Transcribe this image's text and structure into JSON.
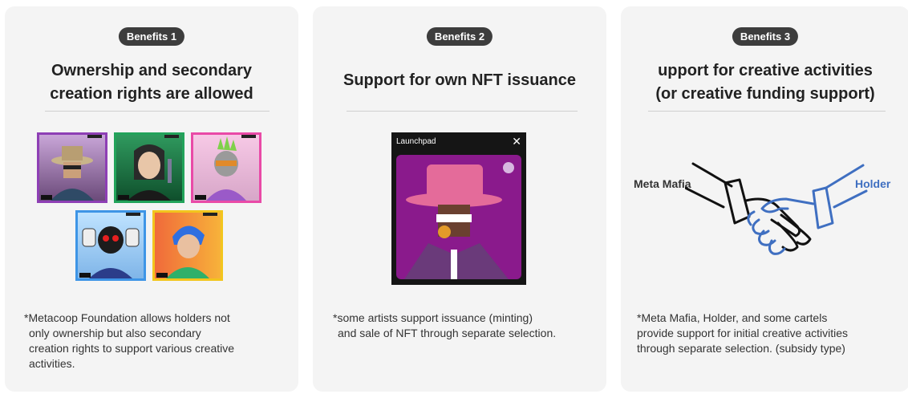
{
  "benefits": [
    {
      "badge": "Benefits 1",
      "title_lines": [
        "Ownership and secondary",
        "creation rights are allowed"
      ],
      "note_lines": [
        "*Metacoop Foundation allows holders not",
        "only ownership but also secondary",
        "creation rights to support various creative",
        "activities."
      ]
    },
    {
      "badge": "Benefits 2",
      "title_lines": [
        "Support for own NFT issuance"
      ],
      "launchpad_title": "Launchpad",
      "close_glyph": "✕",
      "note_lines": [
        "*some artists support issuance (minting)",
        "and sale of NFT through separate selection."
      ]
    },
    {
      "badge": "Benefits 3",
      "title_lines": [
        "upport for creative activities",
        "(or creative funding support)"
      ],
      "left_party": "Meta Mafia",
      "right_party": "Holder",
      "note_lines": [
        "*Meta Mafia, Holder, and some cartels",
        "provide support for initial creative activities",
        "through separate selection. (subsidy type)"
      ]
    }
  ],
  "colors": {
    "card_bg": "#f4f4f4",
    "badge_bg": "#3d3d3d",
    "holder_blue": "#3f6fc1",
    "nft_borders": [
      "#8e3fb5",
      "#22a35a",
      "#e94aa7",
      "#3e95e6",
      "#f2c51d"
    ]
  }
}
